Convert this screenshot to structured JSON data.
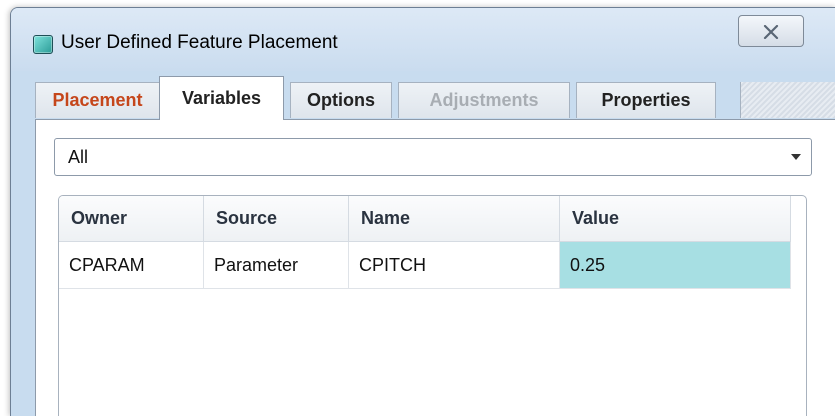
{
  "window": {
    "title": "User Defined Feature Placement",
    "close_icon": "close-icon"
  },
  "tabs": [
    {
      "label": "Placement",
      "state": "highlighted",
      "color": "#c5461b"
    },
    {
      "label": "Variables",
      "state": "active"
    },
    {
      "label": "Options",
      "state": "normal"
    },
    {
      "label": "Adjustments",
      "state": "disabled"
    },
    {
      "label": "Properties",
      "state": "normal"
    }
  ],
  "filter": {
    "selected": "All"
  },
  "table": {
    "columns": [
      "Owner",
      "Source",
      "Name",
      "Value"
    ],
    "rows": [
      {
        "owner": "CPARAM",
        "source": "Parameter",
        "name": "CPITCH",
        "value": "0.25"
      }
    ],
    "selected_cell_color": "#a7dfe3"
  }
}
